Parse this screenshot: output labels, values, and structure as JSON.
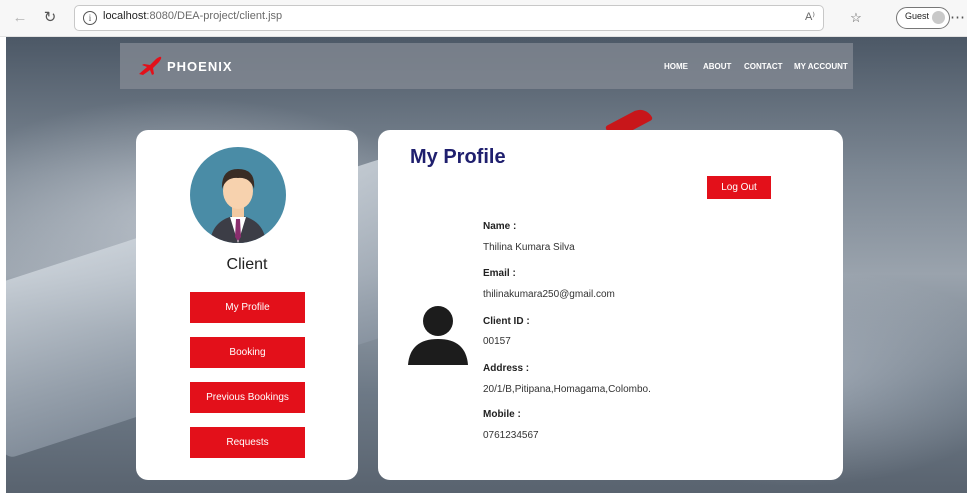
{
  "browser": {
    "url_host": "localhost",
    "url_rest": ":8080/DEA-project/client.jsp",
    "guest_label": "Guest",
    "reader_icon": "A⁾"
  },
  "site_nav": {
    "logo_text": "PHOENIX",
    "links": [
      "HOME",
      "ABOUT",
      "CONTACT",
      "MY ACCOUNT"
    ]
  },
  "sidebar": {
    "title": "Client",
    "buttons": [
      "My Profile",
      "Booking",
      "Previous Bookings",
      "Requests"
    ]
  },
  "profile": {
    "title": "My Profile",
    "logout_label": "Log Out",
    "fields": [
      {
        "label": "Name :",
        "value": "Thilina Kumara Silva"
      },
      {
        "label": "Email :",
        "value": "thilinakumara250@gmail.com"
      },
      {
        "label": "Client ID :",
        "value": "00157"
      },
      {
        "label": "Address :",
        "value": "20/1/B,Pitipana,Homagama,Colombo."
      },
      {
        "label": "Mobile :",
        "value": "0761234567"
      }
    ]
  },
  "colors": {
    "accent_red": "#e3101a",
    "title_navy": "#1f1f6e"
  }
}
